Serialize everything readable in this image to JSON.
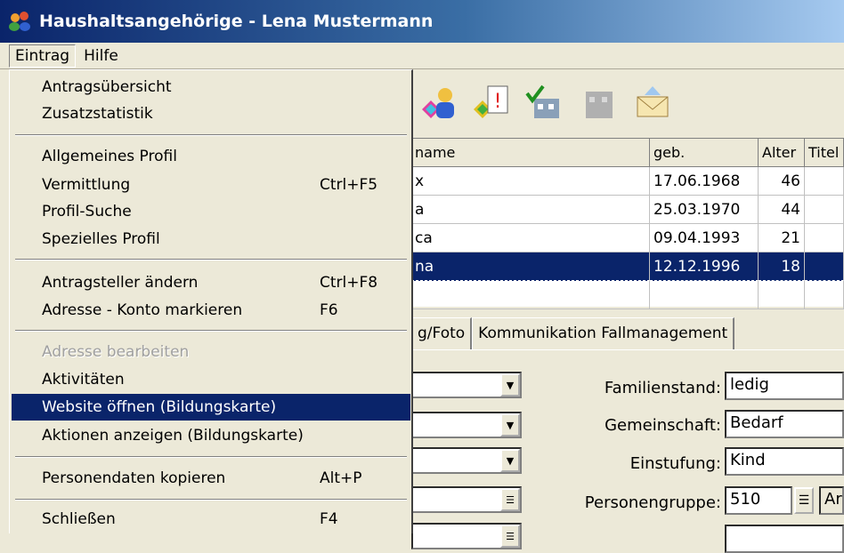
{
  "window": {
    "title": "Haushaltsangehörige - Lena Mustermann"
  },
  "menubar": {
    "items": [
      "Eintrag",
      "Hilfe"
    ]
  },
  "menu": {
    "items": [
      {
        "label": "Antragsübersicht",
        "shortcut": ""
      },
      {
        "label": "Zusatzstatistik",
        "shortcut": ""
      },
      {
        "label": "Allgemeines Profil",
        "shortcut": ""
      },
      {
        "label": "Vermittlung",
        "shortcut": "Ctrl+F5"
      },
      {
        "label": "Profil-Suche",
        "shortcut": ""
      },
      {
        "label": "Spezielles Profil",
        "shortcut": ""
      },
      {
        "label": "Antragsteller ändern",
        "shortcut": "Ctrl+F8"
      },
      {
        "label": "Adresse - Konto markieren",
        "shortcut": "F6"
      },
      {
        "label": "Adresse bearbeiten",
        "shortcut": "",
        "disabled": true
      },
      {
        "label": "Aktivitäten",
        "shortcut": ""
      },
      {
        "label": "Website öffnen (Bildungskarte)",
        "shortcut": "",
        "highlighted": true
      },
      {
        "label": "Aktionen anzeigen (Bildungskarte)",
        "shortcut": ""
      },
      {
        "label": "Personendaten kopieren",
        "shortcut": "Alt+P"
      },
      {
        "label": "Schließen",
        "shortcut": "F4"
      }
    ]
  },
  "grid": {
    "headers": [
      "name",
      "geb.",
      "Alter",
      "Titel"
    ],
    "rows": [
      {
        "name": "x",
        "geb": "17.06.1968",
        "alter": "46",
        "titel": ""
      },
      {
        "name": "a",
        "geb": "25.03.1970",
        "alter": "44",
        "titel": ""
      },
      {
        "name": "ca",
        "geb": "09.04.1993",
        "alter": "21",
        "titel": ""
      },
      {
        "name": "na",
        "geb": "12.12.1996",
        "alter": "18",
        "titel": ""
      }
    ]
  },
  "tabs": [
    "g/Foto",
    "Kommunikation Fallmanagement"
  ],
  "form": {
    "familienstand_label": "Familienstand:",
    "familienstand_value": "ledig",
    "gemeinschaft_label": "Gemeinschaft:",
    "gemeinschaft_value": "Bedarf",
    "einstufung_label": "Einstufung:",
    "einstufung_value": "Kind",
    "personengruppe_label": "Personengruppe:",
    "personengruppe_value": "510",
    "personengruppe_extra": "Ar"
  },
  "colors": {
    "selection": "#0a246a",
    "face": "#ece9d8",
    "titlebar": "#0a246a"
  }
}
